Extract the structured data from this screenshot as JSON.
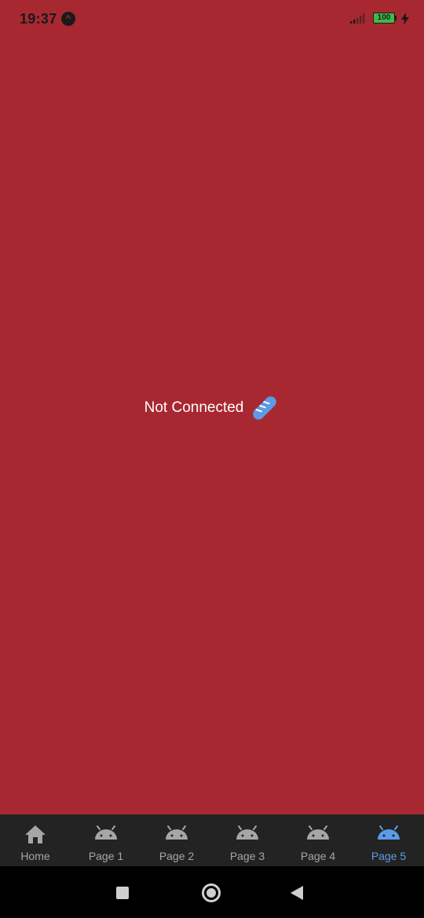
{
  "status_bar": {
    "time": "19:37",
    "app_icon_glyph": "^",
    "battery_level": "100",
    "icons": [
      "signal-icon",
      "battery-icon",
      "charging-bolt-icon"
    ]
  },
  "main": {
    "message": "Not Connected",
    "message_icon": "bread-icon",
    "background_color": "#a82832"
  },
  "tab_bar": {
    "active_color": "#5c9be6",
    "inactive_color": "#a6a6a6",
    "tabs": [
      {
        "label": "Home",
        "icon": "home-icon",
        "active": false
      },
      {
        "label": "Page 1",
        "icon": "android-icon",
        "active": false
      },
      {
        "label": "Page 2",
        "icon": "android-icon",
        "active": false
      },
      {
        "label": "Page 3",
        "icon": "android-icon",
        "active": false
      },
      {
        "label": "Page 4",
        "icon": "android-icon",
        "active": false
      },
      {
        "label": "Page 5",
        "icon": "android-icon",
        "active": true
      }
    ]
  },
  "nav_bar": {
    "buttons": [
      "recents-icon",
      "home-circle-icon",
      "back-icon"
    ]
  }
}
